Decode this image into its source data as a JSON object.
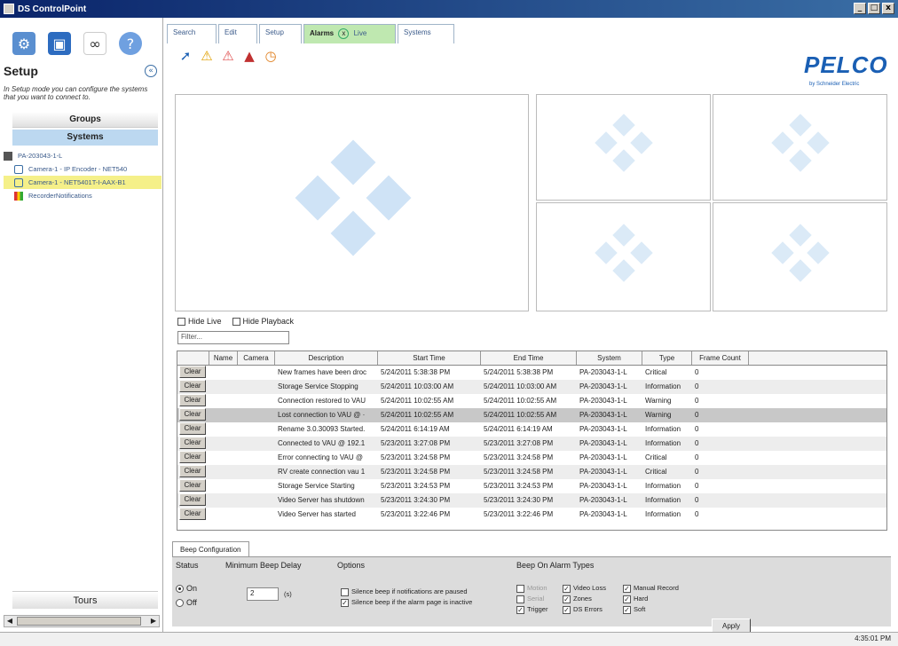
{
  "window": {
    "title": "DS ControlPoint",
    "controls": [
      "_",
      "□",
      "x"
    ]
  },
  "left": {
    "mode_icons": [
      "systems-icon",
      "monitor-icon",
      "binoculars-icon",
      "help-icon"
    ],
    "title": "Setup",
    "collapse_glyph": "«",
    "description": "In Setup mode you can configure the systems that you want to connect to.",
    "groups_label": "Groups",
    "systems_label": "Systems",
    "tree": [
      {
        "label": "PA-203043-1-L",
        "icon": "server-icon"
      },
      {
        "label": "Camera-1 - IP Encoder - NET540",
        "icon": "camera-icon"
      },
      {
        "label": "Camera-1 - NET5401T-I-AAX-B1",
        "icon": "camera-icon"
      },
      {
        "label": "RecorderNotifications",
        "icon": "chart-icon"
      }
    ],
    "tours_label": "Tours"
  },
  "tabs": [
    "Search",
    "Edit",
    "Setup",
    "Alarms",
    "Live",
    "Systems"
  ],
  "tab_close": "x",
  "active_tab": "Alarms",
  "toolbar_icons": [
    "arrow-icon",
    "warning-icon",
    "alarm-icon",
    "siren-icon",
    "clock-icon"
  ],
  "logo": {
    "name": "PELCO",
    "sub": "by Schneider Electric"
  },
  "options": {
    "hide_live": "Hide Live",
    "hide_playback": "Hide Playback",
    "filter_placeholder": "Filter..."
  },
  "alarms": {
    "columns": [
      "",
      "Name",
      "Camera",
      "Description",
      "Start Time",
      "End Time",
      "System",
      "Type",
      "Frame Count"
    ],
    "clear_label": "Clear",
    "rows": [
      {
        "description": "New frames have been droc",
        "start": "5/24/2011 5:38:38 PM",
        "end": "5/24/2011 5:38:38 PM",
        "system": "PA-203043-1-L",
        "type": "Critical",
        "frames": "0"
      },
      {
        "description": "Storage Service Stopping",
        "start": "5/24/2011 10:03:00 AM",
        "end": "5/24/2011 10:03:00 AM",
        "system": "PA-203043-1-L",
        "type": "Information",
        "frames": "0"
      },
      {
        "description": "Connection restored to VAU",
        "start": "5/24/2011 10:02:55 AM",
        "end": "5/24/2011 10:02:55 AM",
        "system": "PA-203043-1-L",
        "type": "Warning",
        "frames": "0"
      },
      {
        "description": "Lost connection to VAU @ ·",
        "start": "5/24/2011 10:02:55 AM",
        "end": "5/24/2011 10:02:55 AM",
        "system": "PA-203043-1-L",
        "type": "Warning",
        "frames": "0"
      },
      {
        "description": "Rename 3.0.30093 Started.",
        "start": "5/24/2011 6:14:19 AM",
        "end": "5/24/2011 6:14:19 AM",
        "system": "PA-203043-1-L",
        "type": "Information",
        "frames": "0"
      },
      {
        "description": "Connected to VAU @ 192.1",
        "start": "5/23/2011 3:27:08 PM",
        "end": "5/23/2011 3:27:08 PM",
        "system": "PA-203043-1-L",
        "type": "Information",
        "frames": "0"
      },
      {
        "description": "Error connecting to VAU @",
        "start": "5/23/2011 3:24:58 PM",
        "end": "5/23/2011 3:24:58 PM",
        "system": "PA-203043-1-L",
        "type": "Critical",
        "frames": "0"
      },
      {
        "description": "RV create connection vau 1",
        "start": "5/23/2011 3:24:58 PM",
        "end": "5/23/2011 3:24:58 PM",
        "system": "PA-203043-1-L",
        "type": "Critical",
        "frames": "0"
      },
      {
        "description": "Storage Service Starting",
        "start": "5/23/2011 3:24:53 PM",
        "end": "5/23/2011 3:24:53 PM",
        "system": "PA-203043-1-L",
        "type": "Information",
        "frames": "0"
      },
      {
        "description": "Video Server has shutdown",
        "start": "5/23/2011 3:24:30 PM",
        "end": "5/23/2011 3:24:30 PM",
        "system": "PA-203043-1-L",
        "type": "Information",
        "frames": "0"
      },
      {
        "description": "Video Server has started",
        "start": "5/23/2011 3:22:46 PM",
        "end": "5/23/2011 3:22:46 PM",
        "system": "PA-203043-1-L",
        "type": "Information",
        "frames": "0"
      }
    ],
    "selected_row": 3
  },
  "beep": {
    "tab_label": "Beep Configuration",
    "status_label": "Status",
    "status_on": "On",
    "status_off": "Off",
    "status_value": "On",
    "delay_label": "Minimum Beep Delay",
    "delay_value": "2",
    "delay_unit": "(s)",
    "options_label": "Options",
    "opt_paused": {
      "label": "Silence beep if notifications are paused",
      "checked": false
    },
    "opt_inactive": {
      "label": "Silence beep if the alarm page is inactive",
      "checked": true
    },
    "types_label": "Beep On Alarm Types",
    "types": [
      {
        "label": "Motion",
        "checked": false,
        "enabled": false
      },
      {
        "label": "Video Loss",
        "checked": true,
        "enabled": true
      },
      {
        "label": "Manual Record",
        "checked": true,
        "enabled": true
      },
      {
        "label": "Serial",
        "checked": false,
        "enabled": false
      },
      {
        "label": "Zones",
        "checked": true,
        "enabled": true
      },
      {
        "label": "Hard",
        "checked": true,
        "enabled": true
      },
      {
        "label": "Trigger",
        "checked": true,
        "enabled": true
      },
      {
        "label": "DS Errors",
        "checked": true,
        "enabled": true
      },
      {
        "label": "Soft",
        "checked": true,
        "enabled": true
      }
    ],
    "apply_label": "Apply"
  },
  "status_time": "4:35:01 PM",
  "colors": {
    "titlebar": "#0a246a",
    "accent": "#1a5fb4",
    "active_tab": "#bfe8b0",
    "selection": "#f5f089",
    "placeholder_diamond": "#cfe3f6"
  }
}
